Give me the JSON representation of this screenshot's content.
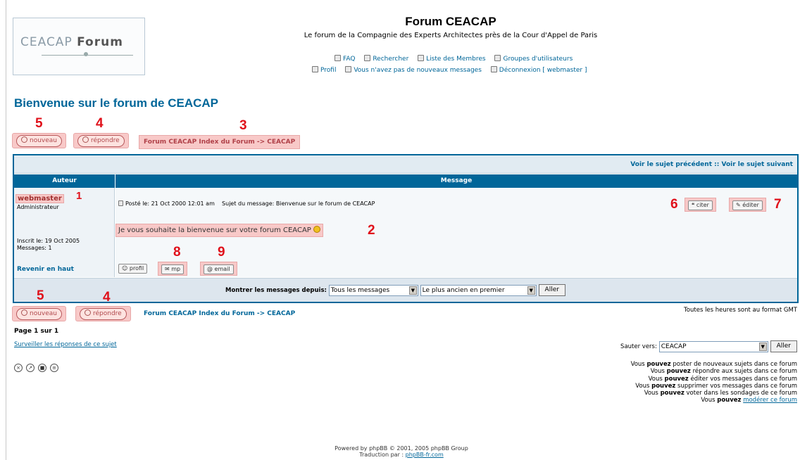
{
  "header": {
    "logo_text_light": "CEACAP",
    "logo_text_bold": "Forum",
    "site_title": "Forum CEACAP",
    "site_description": "Le forum de la Compagnie des Experts Architectes près de la Cour d'Appel de Paris",
    "nav_row1": [
      {
        "label": "FAQ",
        "icon": "faq-icon"
      },
      {
        "label": "Rechercher",
        "icon": "search-icon"
      },
      {
        "label": "Liste des Membres",
        "icon": "members-icon"
      },
      {
        "label": "Groupes d'utilisateurs",
        "icon": "groups-icon"
      }
    ],
    "nav_row2": [
      {
        "label": "Profil",
        "icon": "profile-icon"
      },
      {
        "label": "Vous n'avez pas de nouveaux messages",
        "icon": "messages-icon"
      },
      {
        "label": "Déconnexion [ webmaster ]",
        "icon": "logout-icon"
      }
    ]
  },
  "welcome_title": "Bienvenue sur le forum de CEACAP",
  "actions": {
    "new_label": "nouveau",
    "reply_label": "répondre",
    "breadcrumb": "Forum CEACAP Index du Forum -> CEACAP"
  },
  "topic": {
    "prev_next": "Voir le sujet précédent :: Voir le sujet suivant",
    "col_author": "Auteur",
    "col_message": "Message",
    "author_name": "webmaster",
    "author_rank": "Administrateur",
    "author_joined": "Inscrit le: 19 Oct 2005",
    "author_posts": "Messages: 1",
    "back_to_top": "Revenir en haut",
    "post_meta": "Posté le: 21 Oct 2000 12:01 am    Sujet du message: Bienvenue sur le forum de CEACAP",
    "post_body": "Je vous souhaite la bienvenue sur votre forum CEACAP",
    "quote_label": "citer",
    "edit_label": "éditer",
    "profile_label": "profil",
    "pm_label": "mp",
    "email_label": "email"
  },
  "filter": {
    "label": "Montrer les messages depuis:",
    "period_value": "Tous les messages",
    "order_value": "Le plus ancien en premier",
    "go_label": "Aller"
  },
  "timezone_note": "Toutes les heures sont au format GMT",
  "page_info": "Page 1 sur 1",
  "watch_link": "Surveiller les réponses de ce sujet",
  "jump": {
    "label": "Sauter vers:",
    "value": "CEACAP",
    "go_label": "Aller"
  },
  "permissions": {
    "prefix": "Vous",
    "strong": "pouvez",
    "lines": [
      "poster de nouveaux sujets dans ce forum",
      "répondre aux sujets dans ce forum",
      "éditer vos messages dans ce forum",
      "supprimer vos messages dans ce forum",
      "voter dans les sondages de ce forum"
    ],
    "moderate_link": "modérer ce forum"
  },
  "footer": {
    "powered": "Powered by phpBB © 2001, 2005 phpBB Group",
    "translation": "Traduction par :",
    "translation_link": "phpBB-fr.com"
  },
  "annotations": [
    "1",
    "2",
    "3",
    "4",
    "5",
    "6",
    "7",
    "8",
    "9"
  ],
  "colors": {
    "highlight": "#f8c9c8",
    "annotation": "#e0101a",
    "link": "#006699",
    "header_bar": "#006699"
  }
}
